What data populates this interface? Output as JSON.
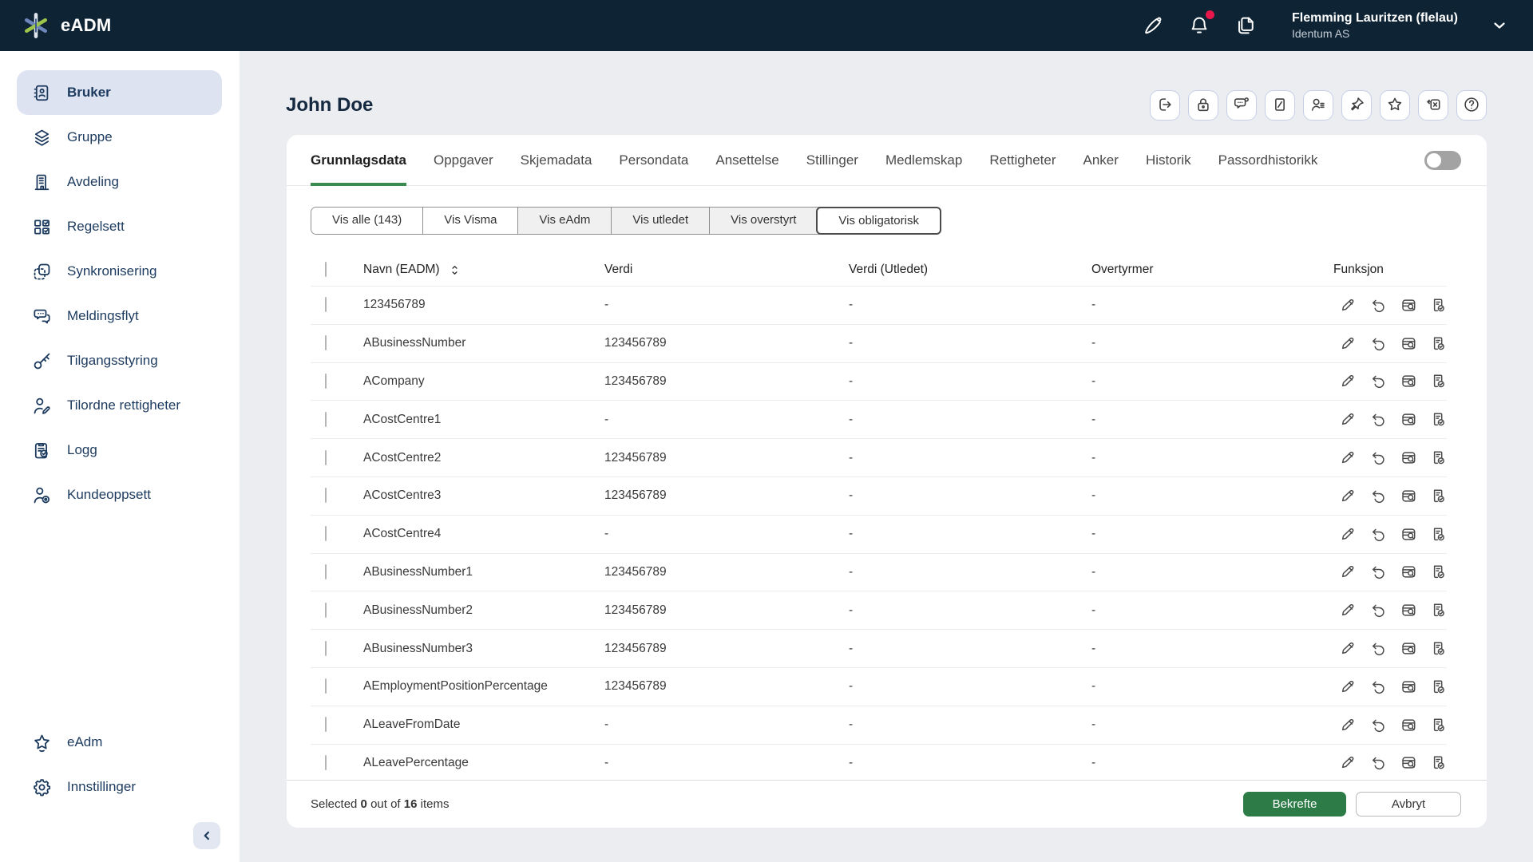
{
  "topbar": {
    "app_name": "eADM",
    "icons": [
      {
        "icon": "pen",
        "badge": false
      },
      {
        "icon": "bell",
        "badge": true
      },
      {
        "icon": "documents",
        "badge": false
      }
    ],
    "user": {
      "name": "Flemming Lauritzen (flelau)",
      "company": "Identum AS"
    }
  },
  "sidebar": {
    "items": [
      {
        "label": "Bruker",
        "icon": "contacts",
        "active": true
      },
      {
        "label": "Gruppe",
        "icon": "layers",
        "active": false
      },
      {
        "label": "Avdeling",
        "icon": "building",
        "active": false
      },
      {
        "label": "Regelsett",
        "icon": "ruleset",
        "active": false
      },
      {
        "label": "Synkronisering",
        "icon": "sync",
        "active": false
      },
      {
        "label": "Meldingsflyt",
        "icon": "chat-flow",
        "active": false
      },
      {
        "label": "Tilgangsstyring",
        "icon": "key",
        "active": false
      },
      {
        "label": "Tilordne rettigheter",
        "icon": "person-edit",
        "active": false
      },
      {
        "label": "Logg",
        "icon": "clipboard-check",
        "active": false
      },
      {
        "label": "Kundeoppsett",
        "icon": "person-gear",
        "active": false
      }
    ],
    "footer_items": [
      {
        "label": "eAdm",
        "icon": "star-flourish",
        "active": false
      },
      {
        "label": "Innstillinger",
        "icon": "gear",
        "active": false
      }
    ]
  },
  "page": {
    "title": "John Doe",
    "toolbar_buttons": [
      {
        "icon": "logout"
      },
      {
        "icon": "lock"
      },
      {
        "icon": "chat-status"
      },
      {
        "icon": "tag"
      },
      {
        "icon": "person-list"
      },
      {
        "icon": "pin"
      },
      {
        "icon": "star"
      },
      {
        "icon": "box-x"
      },
      {
        "icon": "help"
      }
    ],
    "tabs": [
      {
        "label": "Grunnlagsdata",
        "active": true
      },
      {
        "label": "Oppgaver",
        "active": false
      },
      {
        "label": "Skjemadata",
        "active": false
      },
      {
        "label": "Persondata",
        "active": false
      },
      {
        "label": "Ansettelse",
        "active": false
      },
      {
        "label": "Stillinger",
        "active": false
      },
      {
        "label": "Medlemskap",
        "active": false
      },
      {
        "label": "Rettigheter",
        "active": false
      },
      {
        "label": "Anker",
        "active": false
      },
      {
        "label": "Historik",
        "active": false
      },
      {
        "label": "Passordhistorikk",
        "active": false
      }
    ],
    "toggle_on": false,
    "filters": [
      {
        "label": "Vis alle (143)",
        "shaded": false,
        "emphasized": false
      },
      {
        "label": "Vis Visma",
        "shaded": false,
        "emphasized": false
      },
      {
        "label": "Vis eAdm",
        "shaded": true,
        "emphasized": false
      },
      {
        "label": "Vis utledet",
        "shaded": true,
        "emphasized": false
      },
      {
        "label": "Vis overstyrt",
        "shaded": true,
        "emphasized": false
      },
      {
        "label": "Vis obligatorisk",
        "shaded": false,
        "emphasized": true
      }
    ],
    "table": {
      "columns": [
        "Navn (EADM)",
        "Verdi",
        "Verdi (Utledet)",
        "Overtyrmer",
        "Funksjon"
      ],
      "row_actions": [
        "edit",
        "undo",
        "inspect",
        "approve"
      ],
      "rows": [
        {
          "name": "123456789",
          "verdi": "-",
          "utledet": "-",
          "overtyrmer": "-"
        },
        {
          "name": "ABusinessNumber",
          "verdi": "123456789",
          "utledet": "-",
          "overtyrmer": "-"
        },
        {
          "name": "ACompany",
          "verdi": "123456789",
          "utledet": "-",
          "overtyrmer": "-"
        },
        {
          "name": "ACostCentre1",
          "verdi": "-",
          "utledet": "-",
          "overtyrmer": "-"
        },
        {
          "name": "ACostCentre2",
          "verdi": "123456789",
          "utledet": "-",
          "overtyrmer": "-"
        },
        {
          "name": "ACostCentre3",
          "verdi": "123456789",
          "utledet": "-",
          "overtyrmer": "-"
        },
        {
          "name": "ACostCentre4",
          "verdi": "-",
          "utledet": "-",
          "overtyrmer": "-"
        },
        {
          "name": "ABusinessNumber1",
          "verdi": "123456789",
          "utledet": "-",
          "overtyrmer": "-"
        },
        {
          "name": "ABusinessNumber2",
          "verdi": "123456789",
          "utledet": "-",
          "overtyrmer": "-"
        },
        {
          "name": "ABusinessNumber3",
          "verdi": "123456789",
          "utledet": "-",
          "overtyrmer": "-"
        },
        {
          "name": "AEmploymentPositionPercentage",
          "verdi": "123456789",
          "utledet": "-",
          "overtyrmer": "-"
        },
        {
          "name": "ALeaveFromDate",
          "verdi": "-",
          "utledet": "-",
          "overtyrmer": "-"
        },
        {
          "name": "ALeavePercentage",
          "verdi": "-",
          "utledet": "-",
          "overtyrmer": "-"
        }
      ]
    },
    "footer": {
      "selected_prefix": "Selected",
      "selected_count": "0",
      "between": "out of",
      "total_count": "16",
      "suffix": "items",
      "confirm_label": "Bekrefte",
      "cancel_label": "Avbryt"
    }
  },
  "colors": {
    "topbar_bg": "#0e2435",
    "accent_green": "#3a8a4e",
    "confirm_green": "#2d7c47",
    "notification_red": "#e8174b",
    "active_item_bg": "#dee3f2",
    "page_bg": "#ecedf1"
  }
}
